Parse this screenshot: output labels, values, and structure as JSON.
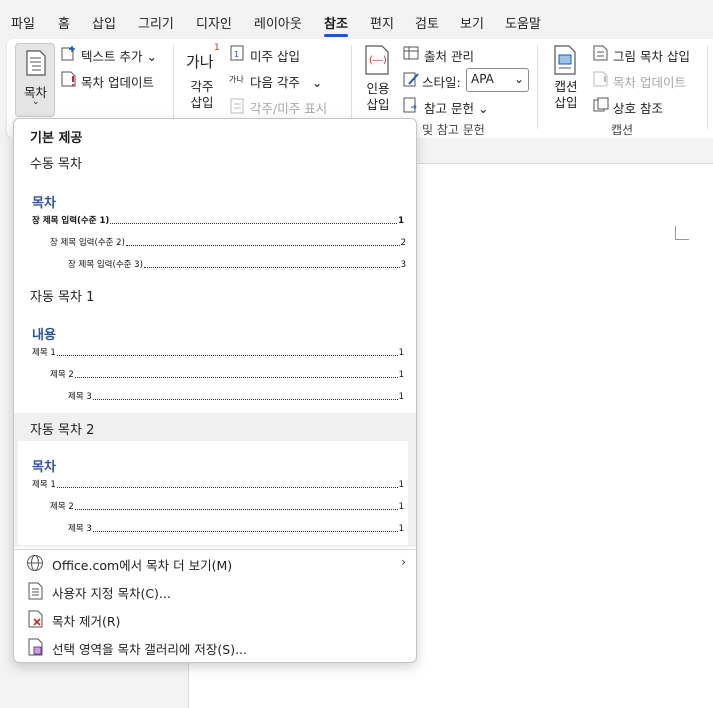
{
  "tabs": [
    "파일",
    "홈",
    "삽입",
    "그리기",
    "디자인",
    "레이아웃",
    "참조",
    "편지",
    "검토",
    "보기",
    "도움말"
  ],
  "ribbon": {
    "toc_label": "목차",
    "add_text": "텍스트 추가",
    "update_table": "목차 업데이트",
    "footnote_big_glyph": "가나",
    "footnote_superscript": "1",
    "insert_footnote": "각주 삽입",
    "insert_endnote": "미주 삽입",
    "next_footnote": "다음 각주",
    "next_footnote_icon_text": "가나",
    "show_notes": "각주/미주 표시",
    "insert_citation": "인용 삽입",
    "manage_sources": "출처 관리",
    "style_label": "스타일:",
    "style_value": "APA",
    "bibliography": "참고 문헌",
    "citations_group": "및 참고 문헌",
    "insert_caption": "캡션 삽입",
    "insert_table_of_figures": "그림 목차 삽입",
    "update_figures_table": "목차 업데이트",
    "cross_reference": "상호 참조",
    "captions_group": "캡션"
  },
  "dropdown": {
    "section_builtin": "기본 제공",
    "manual_toc": "수동 목차",
    "manual_preview": {
      "title": "목차",
      "lines": [
        {
          "text": "장 제목 입력(수준 1)",
          "page": "1"
        },
        {
          "text": "장 제목 입력(수준 2)",
          "page": "2"
        },
        {
          "text": "장 제목 입력(수준 3)",
          "page": "3"
        }
      ]
    },
    "auto_toc_1": "자동 목차 1",
    "auto1_preview": {
      "title": "내용",
      "lines": [
        {
          "text": "제목 1",
          "page": "1"
        },
        {
          "text": "제목 2",
          "page": "1"
        },
        {
          "text": "제목 3",
          "page": "1"
        }
      ]
    },
    "auto_toc_2": "자동 목차 2",
    "auto2_preview": {
      "title": "목차",
      "lines": [
        {
          "text": "제목 1",
          "page": "1"
        },
        {
          "text": "제목 2",
          "page": "1"
        },
        {
          "text": "제목 3",
          "page": "1"
        }
      ]
    },
    "menu": {
      "more_from_office": "Office.com에서 목차 더 보기(M)",
      "custom_toc": "사용자 지정 목차(C)...",
      "remove_toc": "목차 제거(R)",
      "save_selection": "선택 영역을 목차 갤러리에 저장(S)..."
    }
  },
  "colors": {
    "accent": "#185abd",
    "toc_heading": "#2f5496",
    "remove_icon": "#c42b1c"
  }
}
